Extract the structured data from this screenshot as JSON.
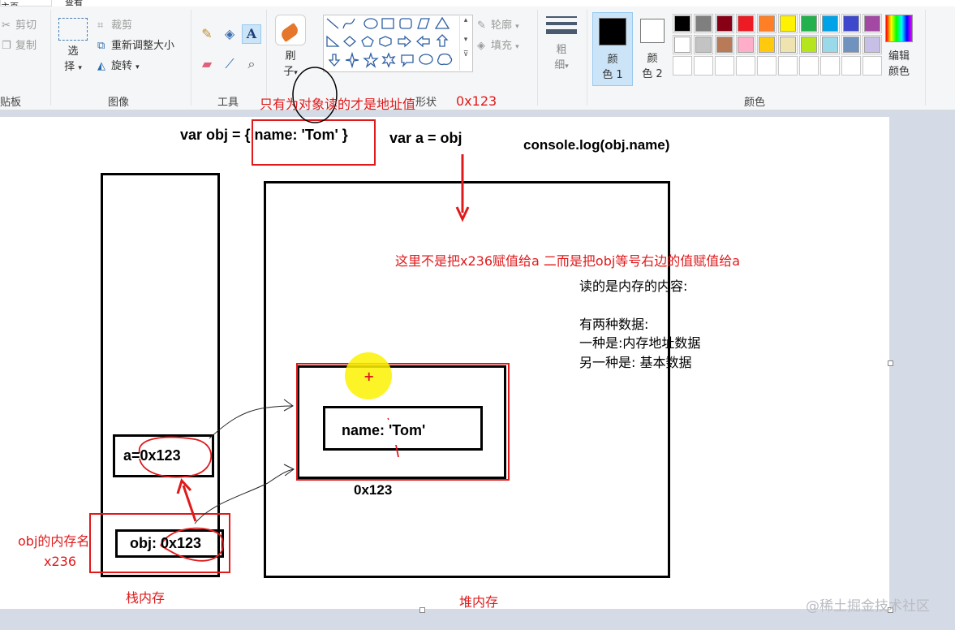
{
  "ribbon": {
    "tabs": [
      "主页",
      "查看"
    ],
    "clipboard": {
      "cut": "剪切",
      "copy": "复制",
      "label": "贴板"
    },
    "image": {
      "select_line1": "选",
      "select_line2": "择",
      "crop": "裁剪",
      "resize": "重新调整大小",
      "rotate": "旋转",
      "label": "图像"
    },
    "tools": {
      "label": "工具"
    },
    "brush": {
      "line1": "刷",
      "line2": "子"
    },
    "shapes": {
      "outline": "轮廓",
      "fill": "填充",
      "label": "形状"
    },
    "size": {
      "line1": "粗",
      "line2": "细"
    },
    "color1": {
      "line1": "颜",
      "line2": "色 1"
    },
    "color2": {
      "line1": "颜",
      "line2": "色 2"
    },
    "edit_colors": {
      "line1": "编辑",
      "line2": "颜色"
    },
    "colors_label": "颜色",
    "palette": [
      "#000000",
      "#7f7f7f",
      "#880015",
      "#ed1c24",
      "#ff7f27",
      "#fff200",
      "#22b14c",
      "#00a2e8",
      "#3f48cc",
      "#a349a4",
      "#ffffff",
      "#c3c3c3",
      "#b97a57",
      "#ffaec9",
      "#ffc90e",
      "#efe4b0",
      "#b5e61d",
      "#99d9ea",
      "#7092be",
      "#c8bfe7"
    ]
  },
  "drawing": {
    "code_obj": "var obj = { name: 'Tom' }",
    "code_a": "var a = obj",
    "code_log": "console.log(obj.name)",
    "note_address": "只有为对象读的才是地址值",
    "address_top": "0x123",
    "not_assign_note": "这里不是把x236赋值给a  二而是把obj等号右边的值赋值给a",
    "read_memory": "读的是内存的内容:",
    "two_kinds": "有两种数据:",
    "kind_one": "一种是:内存地址数据",
    "kind_two": "另一种是:  基本数据",
    "stack_a": "a=0x123",
    "stack_obj": "obj: 0x123",
    "heap_name": "name: 'Tom'",
    "heap_addr": "0x123",
    "obj_mem_name_line1": "obj的内存名",
    "obj_mem_name_line2": "x236",
    "stack_label": "栈内存",
    "heap_label": "堆内存",
    "watermark": "@稀土掘金技术社区"
  }
}
